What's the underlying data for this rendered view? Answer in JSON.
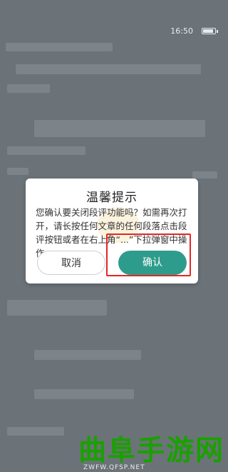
{
  "status": {
    "time": "16:50"
  },
  "dialog": {
    "title": "温馨提示",
    "message": "您确认要关闭段评功能吗？如需再次打开，请长按任何文章的任何段落点击段评按钮或者在右上角“...”下拉弹窗中操作。",
    "cancel_label": "取消",
    "confirm_label": "确认"
  },
  "watermark": {
    "text": "曲阜手游网",
    "url": "ZWFW.QFSP.NET"
  },
  "colors": {
    "accent": "#2e9c8c",
    "highlight": "#e32626",
    "watermark": "#1aa000"
  }
}
